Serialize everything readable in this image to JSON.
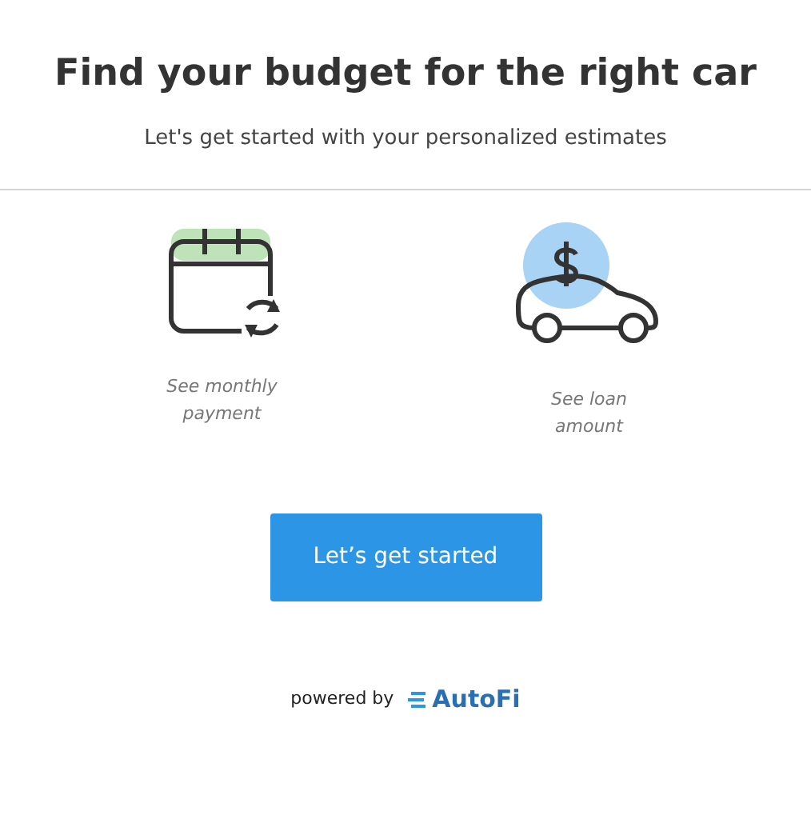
{
  "title": "Find your budget for the right car",
  "subtitle": "Let's get started with your personalized estimates",
  "features": [
    {
      "kind": "calendar",
      "caption_lines": [
        "See monthly",
        "payment"
      ]
    },
    {
      "kind": "car",
      "caption_lines": [
        "See loan",
        "amount"
      ]
    }
  ],
  "button": "Let’s get started",
  "footer": {
    "prefix": "powered by",
    "brand": "AutoFi"
  }
}
